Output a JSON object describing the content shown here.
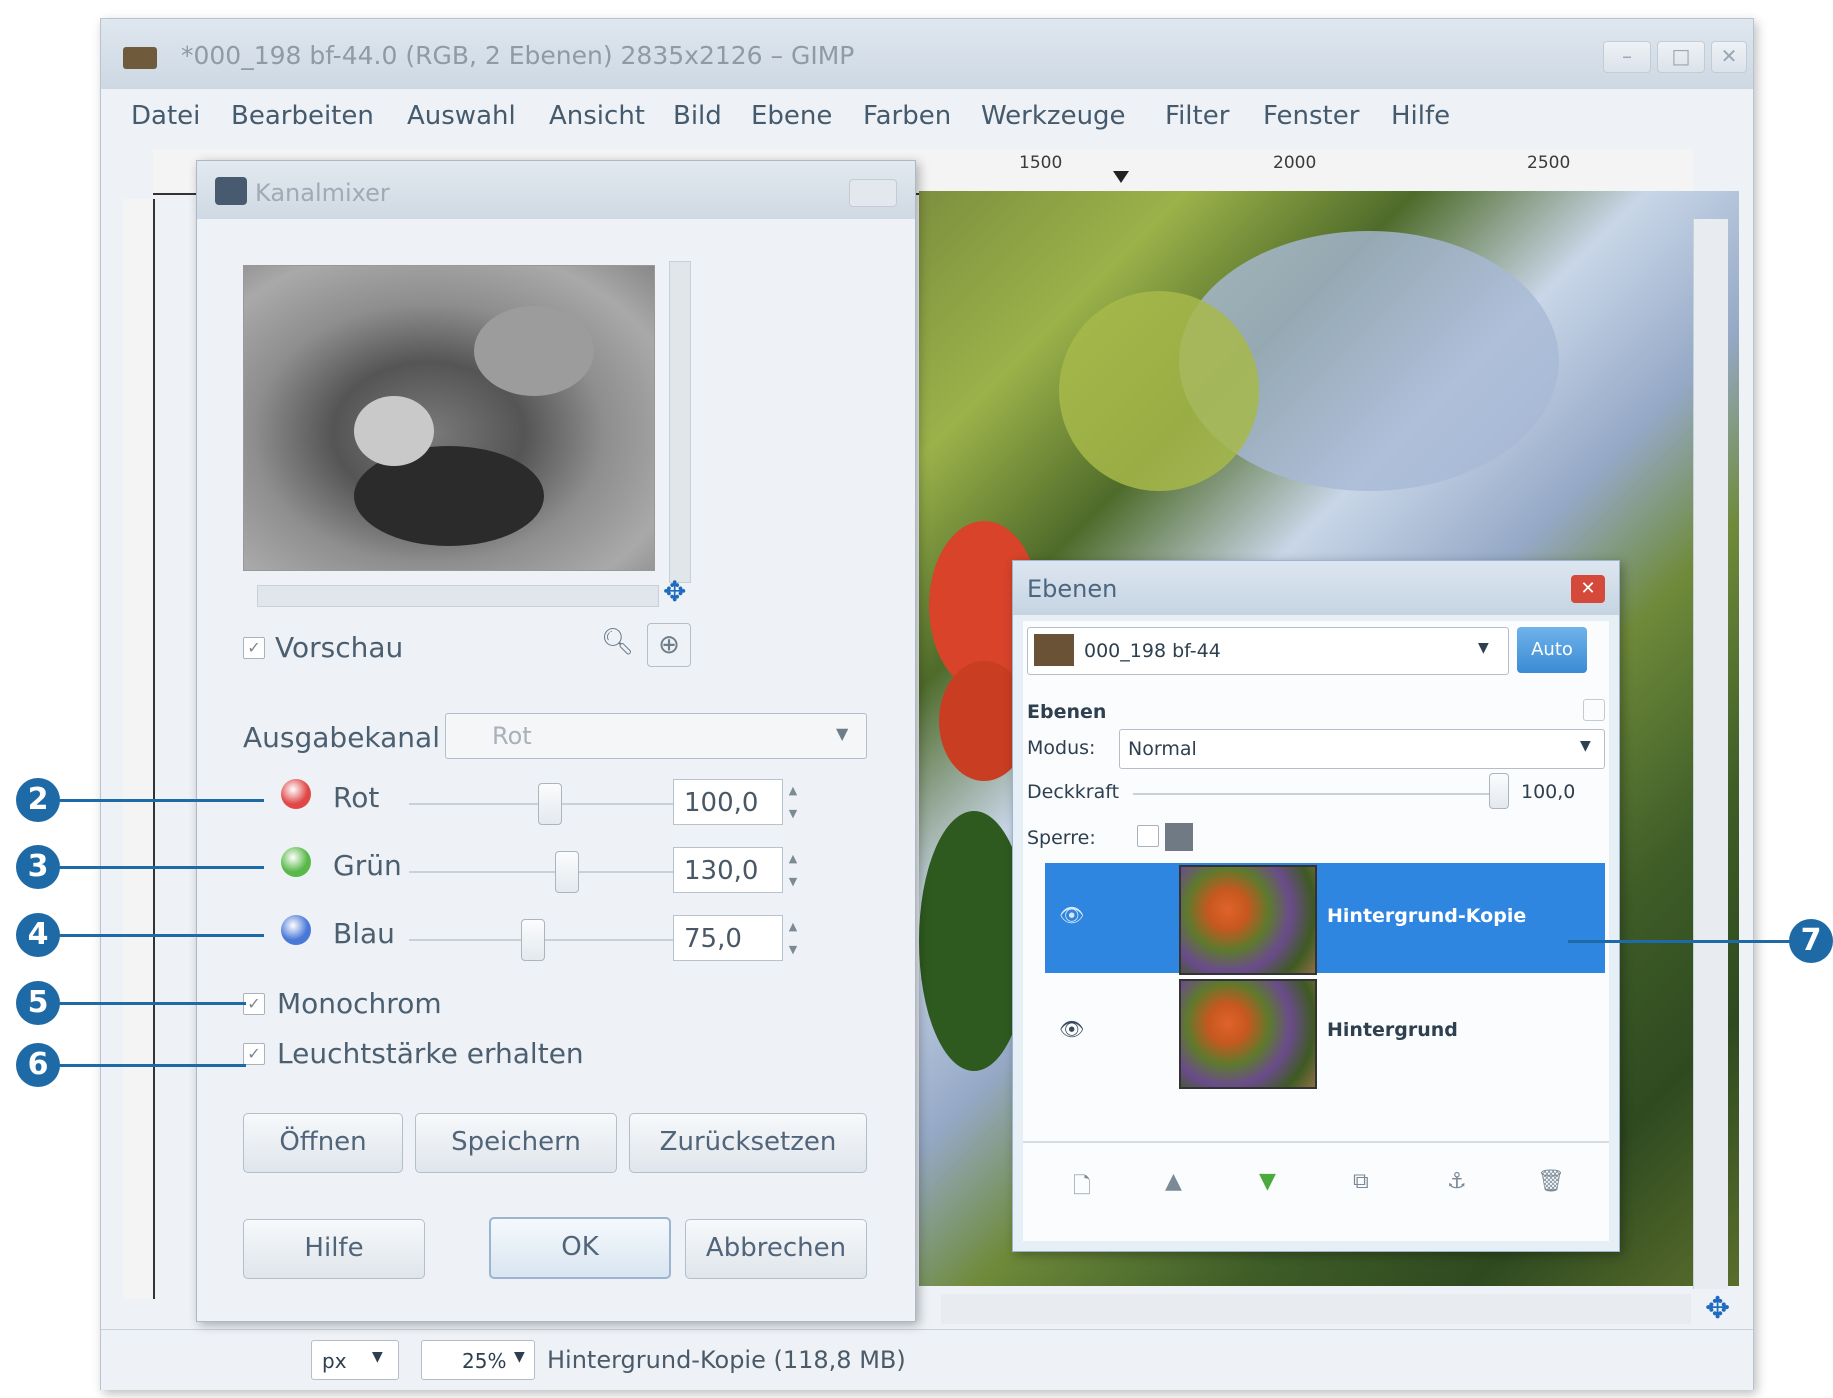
{
  "window": {
    "title": "*000_198 bf-44.0 (RGB, 2 Ebenen) 2835x2126 – GIMP",
    "controls": [
      "–",
      "□",
      "✕"
    ]
  },
  "menu": [
    "Datei",
    "Bearbeiten",
    "Auswahl",
    "Ansicht",
    "Bild",
    "Ebene",
    "Farben",
    "Werkzeuge",
    "Filter",
    "Fenster",
    "Hilfe"
  ],
  "rulers": {
    "top": [
      "1500",
      "2000",
      "2500"
    ]
  },
  "statusbar": {
    "unit": "px",
    "zoom": "25%",
    "info": "Hintergrund-Kopie (118,8 MB)"
  },
  "channel_mixer": {
    "title": "Kanalmixer",
    "preview_label": "Vorschau",
    "preview_checked": true,
    "output_label": "Ausgabekanal",
    "output_value": "Rot",
    "channels": [
      {
        "label": "Rot",
        "value": "100,0",
        "color": "#e04848",
        "fraction": 0.5
      },
      {
        "label": "Grün",
        "value": "130,0",
        "color": "#58b848",
        "fraction": 0.56
      },
      {
        "label": "Blau",
        "value": "75,0",
        "color": "#4a78d8",
        "fraction": 0.44
      }
    ],
    "monochrome_label": "Monochrom",
    "preserve_label": "Leuchtstärke erhalten",
    "buttons": {
      "open": "Öffnen",
      "save": "Speichern",
      "reset": "Zurücksetzen",
      "help": "Hilfe",
      "ok": "OK",
      "cancel": "Abbrechen"
    }
  },
  "layers_dialog": {
    "title": "Ebenen",
    "image_name": "000_198 bf-44",
    "auto_button": "Auto",
    "tab_label": "Ebenen",
    "mode_label": "Modus:",
    "mode_value": "Normal",
    "opacity_label": "Deckkraft",
    "opacity_value": "100,0",
    "lock_label": "Sperre:",
    "layers": [
      {
        "name": "Hintergrund-Kopie",
        "selected": true
      },
      {
        "name": "Hintergrund",
        "selected": false
      }
    ]
  },
  "callouts": [
    "2",
    "3",
    "4",
    "5",
    "6",
    "7"
  ],
  "colors": {
    "accent": "#1e6aa6",
    "selection": "#2f86e0"
  }
}
